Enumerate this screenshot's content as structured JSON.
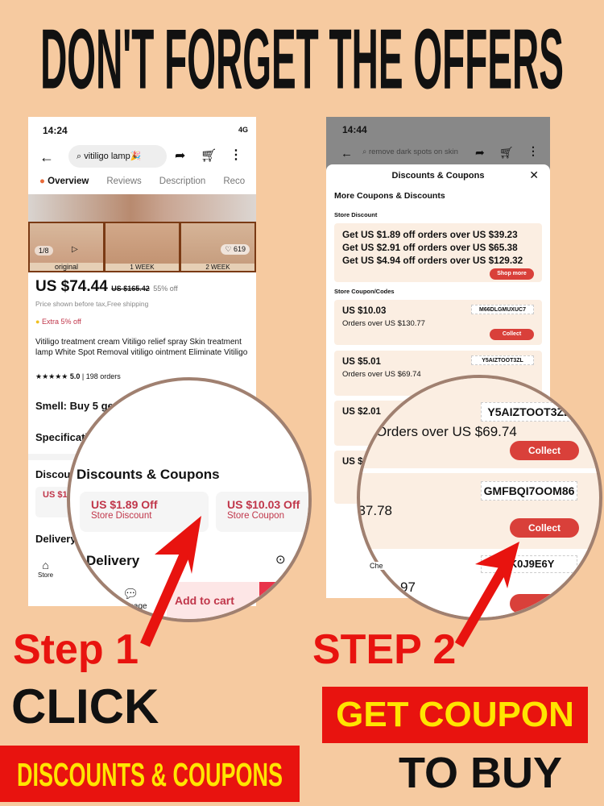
{
  "headline": "DON'T FORGET THE OFFERS",
  "left_phone": {
    "time": "14:24",
    "signal": "4G",
    "search": "vitiligo lamp🎉",
    "tabs": [
      "Overview",
      "Reviews",
      "Description",
      "Reco"
    ],
    "image_counter": "1/8",
    "likes": "619",
    "image_labels": [
      "original",
      "1 WEEK",
      "2 WEEK"
    ],
    "price": "US $74.44",
    "old_price": "US $165.42",
    "discount": "55% off",
    "price_note": "Price shown before tax,Free shipping",
    "extra": "Extra 5% off",
    "product_title": "Vitiligo treatment cream  Vitiligo relief spray  Skin treatment lamp White Spot Removal vitiligo ointment Eliminate Vitiligo",
    "stars": "★★★★★",
    "rating": "5.0",
    "orders": "198 orders",
    "smell": "Smell: Buy 5 get 5 free",
    "specifications": "Specifications",
    "discounts_heading": "Discounts & Coupons",
    "coupons": [
      {
        "amount": "US $1.89 Off",
        "type": "Store Discount"
      },
      {
        "amount": "US $10.03 Off",
        "type": "Store Coupon"
      }
    ],
    "delivery": "Delivery",
    "nav": [
      "Store",
      "Message"
    ],
    "add_to_cart": "Add to cart"
  },
  "right_phone": {
    "time": "14:44",
    "search": "remove dark spots on skin",
    "sheet_title": "Discounts & Coupons",
    "more": "More Coupons & Discounts",
    "store_discount": "Store Discount",
    "discount_lines": [
      "Get US $1.89 off orders over US $39.23",
      "Get US $2.91 off orders over US $65.38",
      "Get US $4.94 off orders over US $129.32"
    ],
    "shop_more": "Shop more",
    "codes_heading": "Store Coupon/Codes",
    "codes": [
      {
        "amount": "US $10.03",
        "min": "Orders over US $130.77",
        "code": "M66DLGMUXUC7"
      },
      {
        "amount": "US $5.01",
        "min": "Orders over US $69.74",
        "code": "Y5AIZTOOT3ZL"
      },
      {
        "amount": "US $2.01",
        "min": "Orders over US $69.74",
        "code": "Y5AIZTOOT3ZL"
      },
      {
        "amount": "US $",
        "min": "Orders over US $37.78",
        "code": "GMFBQI7OOM86"
      },
      {
        "code": "5K0J9E6Y"
      }
    ],
    "collect": "Collect",
    "footer_fragment": "Che",
    "footer_amount": "97"
  },
  "step1": "Step 1",
  "click": "CLICK",
  "banner1": "DISCOUNTS & COUPONS",
  "step2": "STEP 2",
  "banner2": "GET COUPON",
  "to_buy": "TO BUY",
  "colors": {
    "background": "#f6caa0",
    "accent_red": "#e8130f",
    "banner_text": "#ffe500",
    "coupon_red": "#c0364a"
  }
}
